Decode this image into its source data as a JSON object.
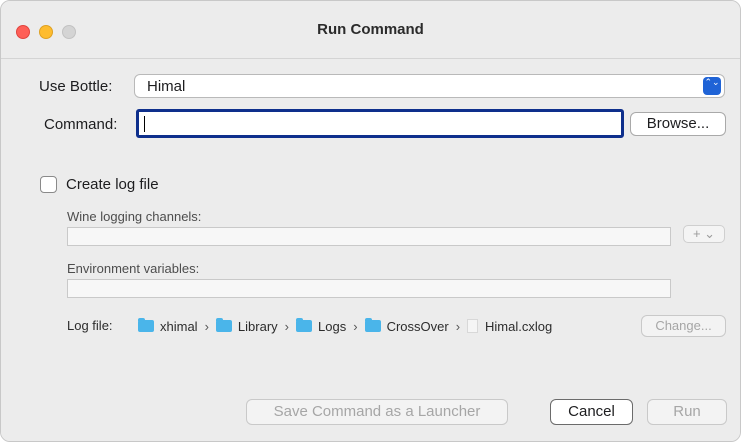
{
  "window": {
    "title": "Run Command"
  },
  "bottle": {
    "label": "Use Bottle:",
    "value": "Himal",
    "arrows": "⌃⌄"
  },
  "command": {
    "label": "Command:",
    "value": "",
    "browse_label": "Browse..."
  },
  "log": {
    "checkbox_label": "Create log file",
    "checked": false,
    "wine_channels_label": "Wine logging channels:",
    "wine_channels_value": "",
    "plus_button": "+ ⌄",
    "env_vars_label": "Environment variables:",
    "env_vars_value": "",
    "log_file_label": "Log file:",
    "path": [
      "xhimal",
      "Library",
      "Logs",
      "CrossOver",
      "Himal.cxlog"
    ],
    "separator": "›",
    "change_label": "Change..."
  },
  "footer": {
    "save_launcher_label": "Save Command as a Launcher",
    "cancel_label": "Cancel",
    "run_label": "Run"
  }
}
